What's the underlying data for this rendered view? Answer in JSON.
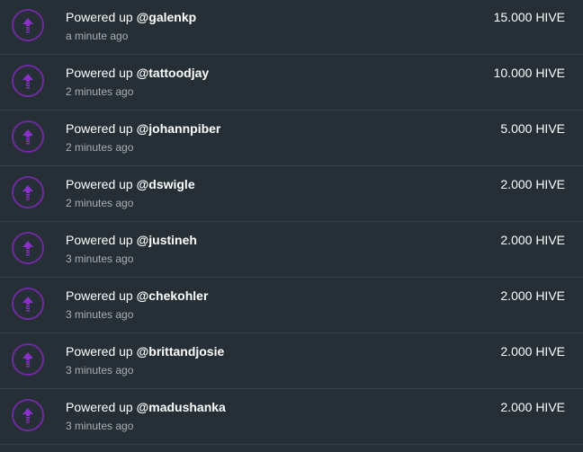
{
  "colors": {
    "background": "#262f35",
    "divider": "#34414a",
    "icon_accent": "#6f2a9f",
    "text_primary": "#ffffff",
    "text_secondary": "#a7b0b6"
  },
  "activity": {
    "icon_name": "power-up-arrow-icon",
    "items": [
      {
        "action": "Powered up",
        "user": "@galenkp",
        "time": "a minute ago",
        "amount": "15.000 HIVE"
      },
      {
        "action": "Powered up",
        "user": "@tattoodjay",
        "time": "2 minutes ago",
        "amount": "10.000 HIVE"
      },
      {
        "action": "Powered up",
        "user": "@johannpiber",
        "time": "2 minutes ago",
        "amount": "5.000 HIVE"
      },
      {
        "action": "Powered up",
        "user": "@dswigle",
        "time": "2 minutes ago",
        "amount": "2.000 HIVE"
      },
      {
        "action": "Powered up",
        "user": "@justineh",
        "time": "3 minutes ago",
        "amount": "2.000 HIVE"
      },
      {
        "action": "Powered up",
        "user": "@chekohler",
        "time": "3 minutes ago",
        "amount": "2.000 HIVE"
      },
      {
        "action": "Powered up",
        "user": "@brittandjosie",
        "time": "3 minutes ago",
        "amount": "2.000 HIVE"
      },
      {
        "action": "Powered up",
        "user": "@madushanka",
        "time": "3 minutes ago",
        "amount": "2.000 HIVE"
      }
    ]
  }
}
